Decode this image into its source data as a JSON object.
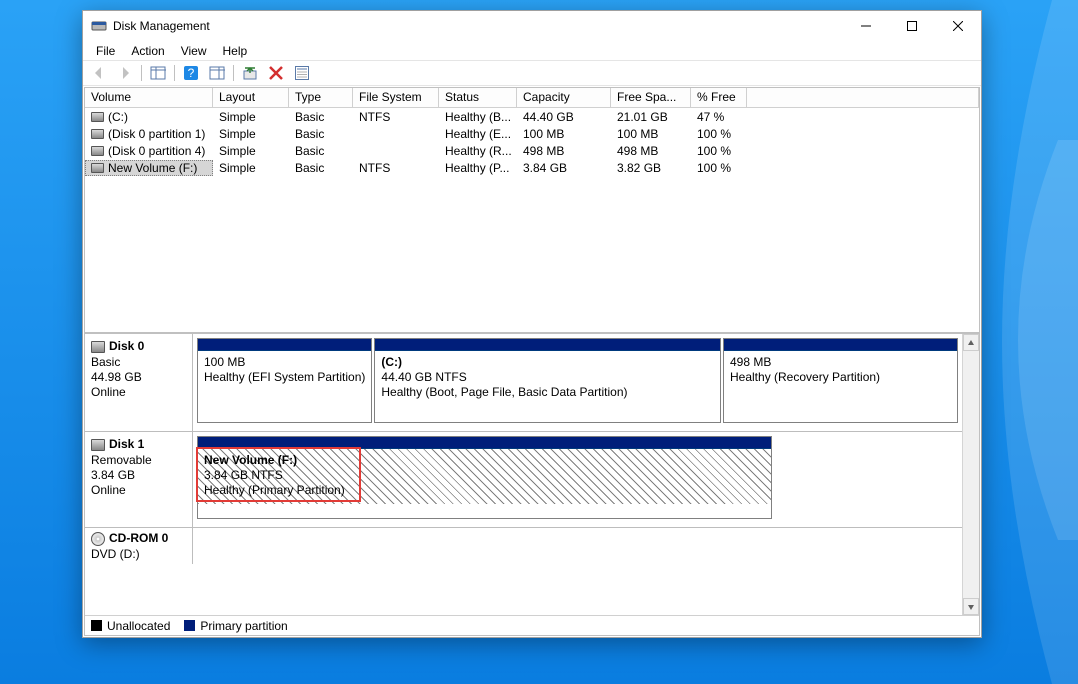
{
  "window": {
    "title": "Disk Management"
  },
  "menu": {
    "file": "File",
    "action": "Action",
    "view": "View",
    "help": "Help"
  },
  "columns": {
    "volume": "Volume",
    "layout": "Layout",
    "type": "Type",
    "fs": "File System",
    "status": "Status",
    "capacity": "Capacity",
    "free": "Free Spa...",
    "pct": "% Free"
  },
  "rows": [
    {
      "volume": "(C:)",
      "layout": "Simple",
      "type": "Basic",
      "fs": "NTFS",
      "status": "Healthy (B...",
      "capacity": "44.40 GB",
      "free": "21.01 GB",
      "pct": "47 %"
    },
    {
      "volume": "(Disk 0 partition 1)",
      "layout": "Simple",
      "type": "Basic",
      "fs": "",
      "status": "Healthy (E...",
      "capacity": "100 MB",
      "free": "100 MB",
      "pct": "100 %"
    },
    {
      "volume": "(Disk 0 partition 4)",
      "layout": "Simple",
      "type": "Basic",
      "fs": "",
      "status": "Healthy (R...",
      "capacity": "498 MB",
      "free": "498 MB",
      "pct": "100 %"
    },
    {
      "volume": "New Volume (F:)",
      "layout": "Simple",
      "type": "Basic",
      "fs": "NTFS",
      "status": "Healthy (P...",
      "capacity": "3.84 GB",
      "free": "3.82 GB",
      "pct": "100 %"
    }
  ],
  "disks": {
    "d0": {
      "name": "Disk 0",
      "type": "Basic",
      "size": "44.98 GB",
      "state": "Online"
    },
    "d1": {
      "name": "Disk 1",
      "type": "Removable",
      "size": "3.84 GB",
      "state": "Online"
    },
    "cd": {
      "name": "CD-ROM 0",
      "type": "DVD (D:)"
    }
  },
  "parts": {
    "p0": {
      "title": "",
      "line2": "100 MB",
      "line3": "Healthy (EFI System Partition)"
    },
    "p1": {
      "title": "(C:)",
      "line2": "44.40 GB NTFS",
      "line3": "Healthy (Boot, Page File, Basic Data Partition)"
    },
    "p2": {
      "title": "",
      "line2": "498 MB",
      "line3": "Healthy (Recovery Partition)"
    },
    "pf": {
      "title": "New Volume  (F:)",
      "line2": "3.84 GB NTFS",
      "line3": "Healthy (Primary Partition)"
    }
  },
  "legend": {
    "unalloc": "Unallocated",
    "primary": "Primary partition"
  }
}
